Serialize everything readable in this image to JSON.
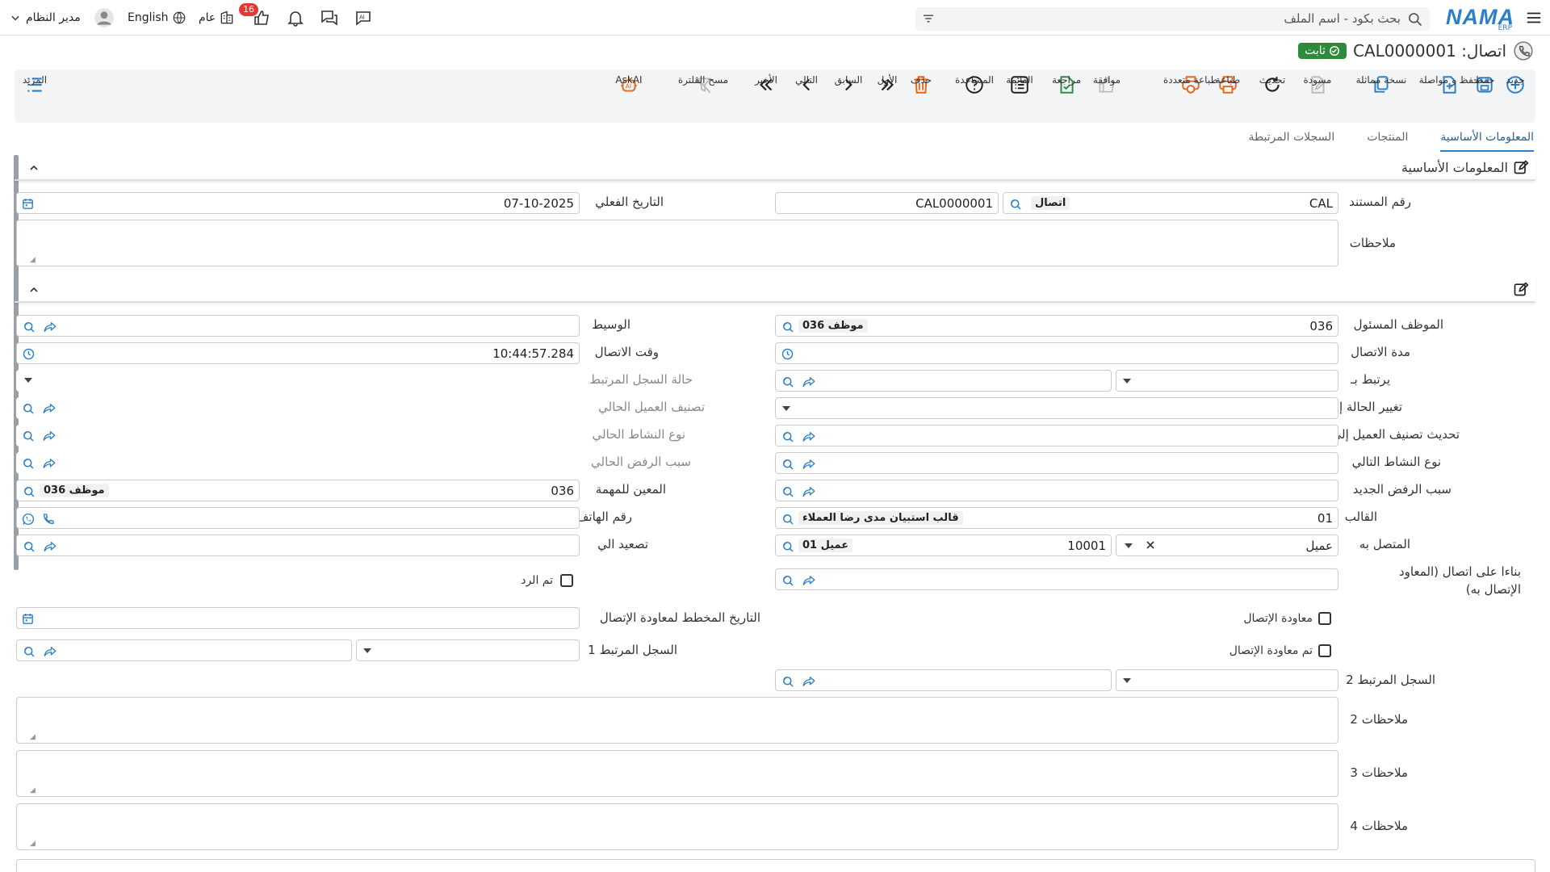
{
  "topbar": {
    "search_placeholder": "بحث بكود - اسم الملف",
    "logo": "NAMA",
    "logo_sub": "ERP",
    "notif_count": "16",
    "branch": "عام",
    "language": "English",
    "user": "مدير النظام"
  },
  "title": {
    "text": "اتصال: CAL0000001",
    "status": "ثابت"
  },
  "toolbar": {
    "new": "جديد",
    "save": "حفظ",
    "save_continue": "حفظ و مواصلة",
    "duplicate": "نسخة مماثلة",
    "draft": "مسودة",
    "refresh": "تحديث",
    "print": "طباعة",
    "multi_print": "طباعة متعددة",
    "approve": "موافقة",
    "review": "مراجعة",
    "list": "القائمة",
    "help": "المساعدة",
    "delete": "حذف",
    "first": "الأول",
    "previous": "السابق",
    "next": "التالي",
    "last": "الأخير",
    "clear_filter": "مسح الفلترة",
    "askai": "AskAI",
    "more": "المزيد"
  },
  "tabs": [
    "المعلومات الأساسية",
    "المنتجات",
    "السجلات المرتبطة"
  ],
  "section1": {
    "title": "المعلومات الأساسية",
    "doc_number_label": "رقم المستند",
    "doc_prefix": "CAL",
    "doc_type": "اتصال",
    "doc_code": "CAL0000001",
    "actual_date_label": "التاريخ الفعلي",
    "actual_date": "07-10-2025",
    "notes_label": "ملاحظات"
  },
  "section2": {
    "responsible_label": "الموظف المسئول",
    "responsible_code": "036",
    "responsible_name": "موظف 036",
    "mediator_label": "الوسيط",
    "duration_label": "مدة الاتصال",
    "call_time_label": "وقت الاتصال",
    "call_time": "10:44:57.284",
    "related_to_label": "يرتبط بـ",
    "related_status_label": "حالة السجل المرتبط",
    "change_status_label": "تغيير الحالة إلى",
    "current_class_label": "تصنيف العميل الحالي",
    "update_class_label": "تحديث تصنيف العميل إلى",
    "current_activity_label": "نوع النشاط الحالي",
    "next_activity_label": "نوع النشاط التالي",
    "current_reject_label": "سبب الرفض الحالي",
    "new_reject_label": "سبب الرفض الجديد",
    "assignee_label": "المعين للمهمة",
    "assignee_code": "036",
    "assignee_name": "موظف 036",
    "template_label": "القالب",
    "template_code": "01",
    "template_name": "قالب استبيان مدى رضا العملاء",
    "phone_label": "رقم الهاتف",
    "contact_label": "المتصل به",
    "contact_type": "عميل",
    "contact_code": "10001",
    "contact_name": "عميل 01",
    "escalate_label": "تصعيد الي",
    "based_on_label": "بناءا على اتصال (المعاود الإتصال به)",
    "replied_label": "تم الرد",
    "callback_label": "معاودة الإتصال",
    "planned_date_label": "التاريخ المخطط لمعاودة الإتصال",
    "called_back_label": "تم معاودة الإتصال",
    "related1_label": "السجل المرتبط 1",
    "related2_label": "السجل المرتبط 2",
    "notes2_label": "ملاحظات 2",
    "notes3_label": "ملاحظات 3",
    "notes4_label": "ملاحظات 4"
  },
  "colors": {
    "accent": "#2a7fc9",
    "status_green": "#2e8b3d",
    "orange": "#e8651a"
  }
}
